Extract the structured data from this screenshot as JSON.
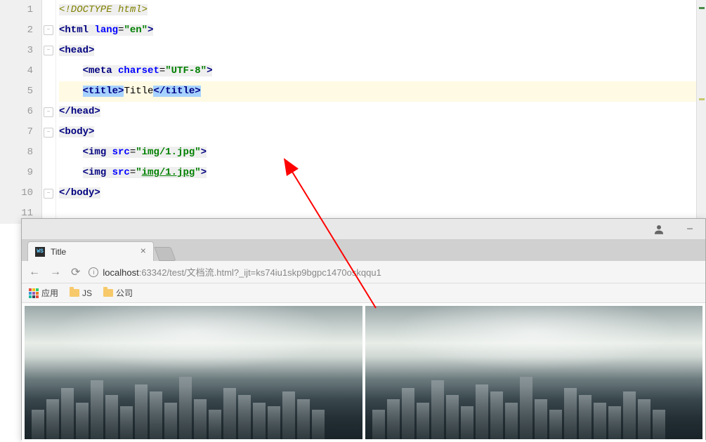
{
  "editor": {
    "line_numbers": [
      "1",
      "2",
      "3",
      "4",
      "5",
      "6",
      "7",
      "8",
      "9",
      "10",
      "11"
    ],
    "lines": {
      "l1": {
        "doctype": "<!DOCTYPE html>"
      },
      "l2": {
        "open": "<",
        "tag": "html ",
        "attr": "lang",
        "eq": "=",
        "str": "\"en\"",
        "close": ">"
      },
      "l3": {
        "open": "<",
        "tag": "head",
        "close": ">"
      },
      "l4": {
        "indent": "    ",
        "open": "<",
        "tag": "meta ",
        "attr": "charset",
        "eq": "=",
        "str": "\"UTF-8\"",
        "close": ">"
      },
      "l5": {
        "indent": "    ",
        "open": "<",
        "tag": "title",
        "close": ">",
        "text": "Title",
        "open2": "</",
        "tag2": "title",
        "close2": ">"
      },
      "l6": {
        "open": "</",
        "tag": "head",
        "close": ">"
      },
      "l7": {
        "open": "<",
        "tag": "body",
        "close": ">"
      },
      "l8": {
        "indent": "    ",
        "open": "<",
        "tag": "img ",
        "attr": "src",
        "eq": "=",
        "str": "\"img/1.jpg\"",
        "close": ">"
      },
      "l9": {
        "indent": "    ",
        "open": "<",
        "tag": "img ",
        "attr": "src",
        "eq": "=",
        "strq": "\"",
        "strval": "img/1.jpg",
        "strq2": "\"",
        "close": ">"
      },
      "l10": {
        "open": "</",
        "tag": "body",
        "close": ">"
      }
    }
  },
  "browser": {
    "tab": {
      "favicon": "WS",
      "title": "Title"
    },
    "url": {
      "host": "localhost",
      "port": ":63342",
      "path": "/test/文档流.html?_ijt=ks74iu1skp9bgpc1470oskqqu1"
    },
    "bookmarks": {
      "apps": "应用",
      "b1": "JS",
      "b2": "公司"
    }
  }
}
